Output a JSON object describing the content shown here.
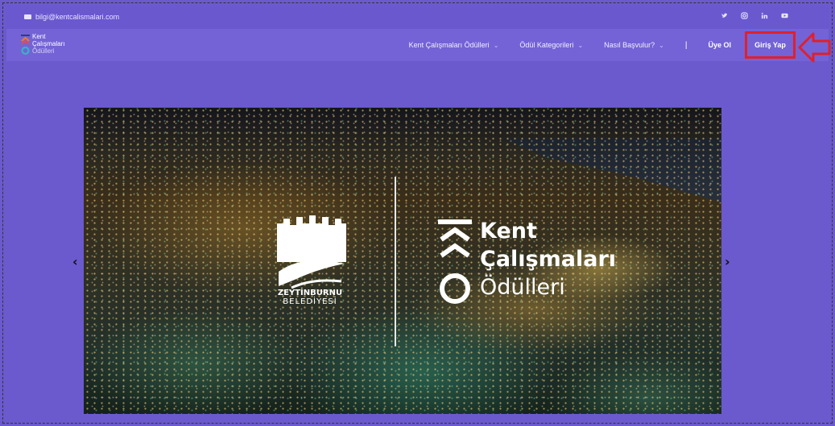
{
  "topbar": {
    "email": "bilgi@kentcalismalari.com",
    "social_icons": [
      "twitter-icon",
      "instagram-icon",
      "linkedin-icon",
      "youtube-icon"
    ]
  },
  "logo": {
    "line1": "Kent",
    "line2": "Çalışmaları",
    "line3": "Ödülleri"
  },
  "nav": {
    "items": [
      {
        "label": "Kent Çalışmaları Ödülleri"
      },
      {
        "label": "Ödül Kategorileri"
      },
      {
        "label": "Nasıl Başvulur?"
      }
    ],
    "separator": "|",
    "register": "Üye Ol",
    "login": "Giriş Yap"
  },
  "carousel": {
    "prev": "‹",
    "next": "›",
    "slide": {
      "left_logo": {
        "line1": "ZEYTİNBURNU",
        "line2": "BELEDİYESİ"
      },
      "right_logo": {
        "line1": "Kent",
        "line2": "Çalışmaları",
        "line3": "Ödülleri"
      }
    }
  },
  "colors": {
    "page_bg": "#6a5acd",
    "highlight": "#e0202c"
  }
}
